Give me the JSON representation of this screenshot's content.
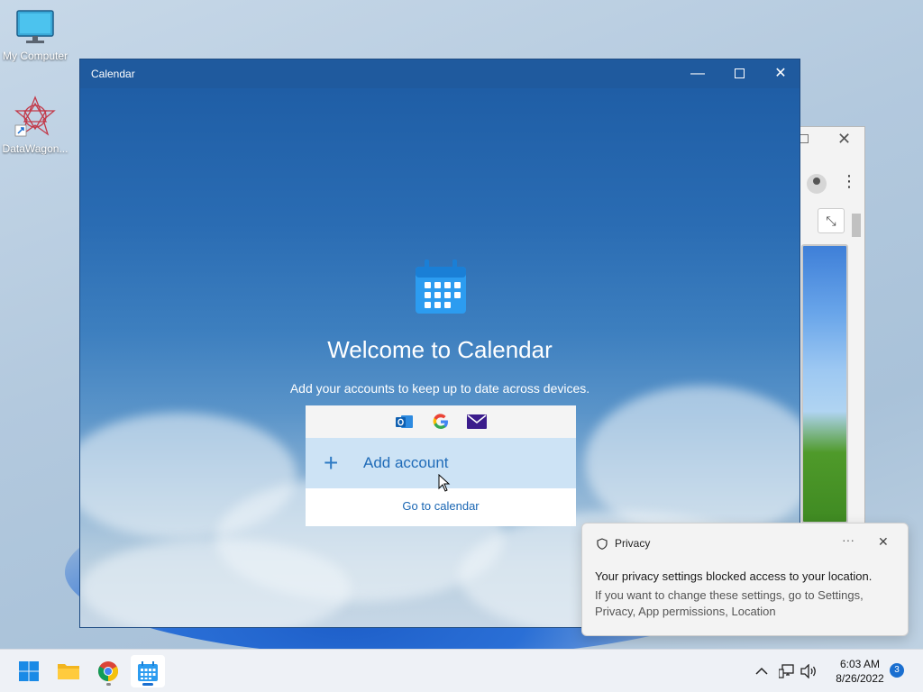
{
  "desktop": {
    "icons": [
      {
        "label": "My Computer",
        "icon": "monitor-icon"
      },
      {
        "label": "DataWagon...",
        "icon": "datawagon-icon"
      }
    ]
  },
  "calendar_window": {
    "title": "Calendar",
    "controls": {
      "minimize": "—",
      "maximize": "☐",
      "close": "✕"
    },
    "welcome_title": "Welcome to Calendar",
    "subtitle": "Add your accounts to keep up to date across devices.",
    "account_providers": [
      "outlook-icon",
      "google-icon",
      "mail-icon"
    ],
    "add_account_label": "Add account",
    "go_to_calendar_label": "Go to calendar"
  },
  "background_window": {
    "icons": [
      "maximize-icon",
      "close-icon",
      "profile-icon",
      "menu-icon",
      "collapse-icon"
    ]
  },
  "toast": {
    "title": "Privacy",
    "more": "···",
    "close": "✕",
    "message": "Your privacy settings blocked access to your location.",
    "detail": "If you want to change these settings, go to Settings, Privacy, App permissions, Location"
  },
  "taskbar": {
    "apps": [
      "start-icon",
      "file-explorer-icon",
      "chrome-icon",
      "calendar-icon"
    ],
    "active_app": "calendar-icon",
    "tray_chevron": "^",
    "time": "6:03 AM",
    "date": "8/26/2022",
    "notification_count": "3"
  },
  "colors": {
    "accent": "#1a6fd0",
    "titlebar": "#1f5a9e",
    "add_row_bg": "#cde3f5",
    "link": "#1a66b3"
  }
}
